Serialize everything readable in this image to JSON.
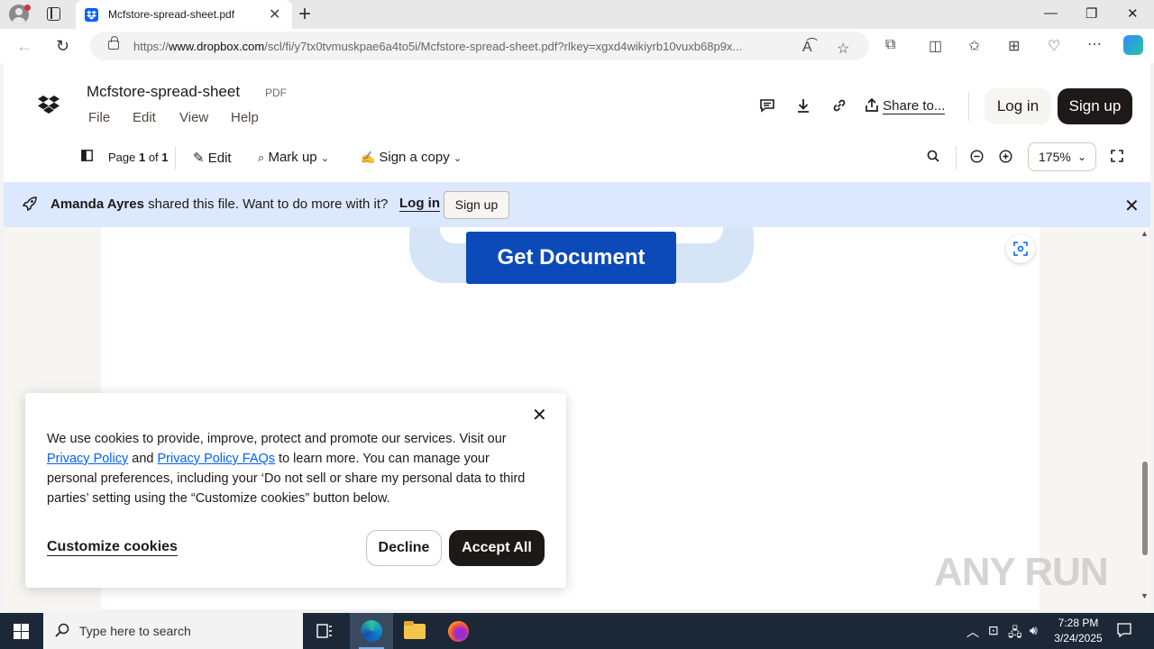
{
  "browser": {
    "tab_title": "Mcfstore-spread-sheet.pdf",
    "url_prefix": "https://",
    "url_host": "www.dropbox.com",
    "url_rest": "/scl/fi/y7tx0tvmuskpae6a4to5i/Mcfstore-spread-sheet.pdf?rlkey=xgxd4wikiyrb10vuxb68p9x..."
  },
  "header": {
    "file_title": "Mcfstore-spread-sheet",
    "file_type": "PDF",
    "menu": [
      "File",
      "Edit",
      "View",
      "Help"
    ],
    "share_label": "Share to...",
    "login_label": "Log in",
    "signup_label": "Sign up"
  },
  "toolbar": {
    "page_prefix": "Page ",
    "page_current": "1",
    "page_of": " of ",
    "page_total": "1",
    "edit_label": "Edit",
    "markup_label": "Mark up",
    "sign_label": "Sign a copy",
    "zoom_value": "175%"
  },
  "banner": {
    "sharer": "Amanda Ayres",
    "message": " shared this file. Want to do more with it?",
    "login_label": "Log in",
    "signup_label": "Sign up"
  },
  "document": {
    "button_label": "Get Document"
  },
  "cookie": {
    "text_1": "We use cookies to provide, improve, protect and promote our services. Visit our ",
    "link_1": "Privacy Policy",
    "text_2": " and ",
    "link_2": "Privacy Policy FAQs",
    "text_3": " to learn more. You can manage your personal preferences, including your ‘Do not sell or share my personal data to third parties’ setting using the “Customize cookies” button below.",
    "customize_label": "Customize cookies",
    "decline_label": "Decline",
    "accept_label": "Accept All"
  },
  "watermark": "ANY RUN",
  "taskbar": {
    "search_placeholder": "Type here to search",
    "time": "7:28 PM",
    "date": "3/24/2025"
  },
  "colors": {
    "dropbox_blue": "#0061fe",
    "banner_bg": "#dbe8fe",
    "dark_button": "#1e1919",
    "get_document_blue": "#0b4ab8"
  }
}
